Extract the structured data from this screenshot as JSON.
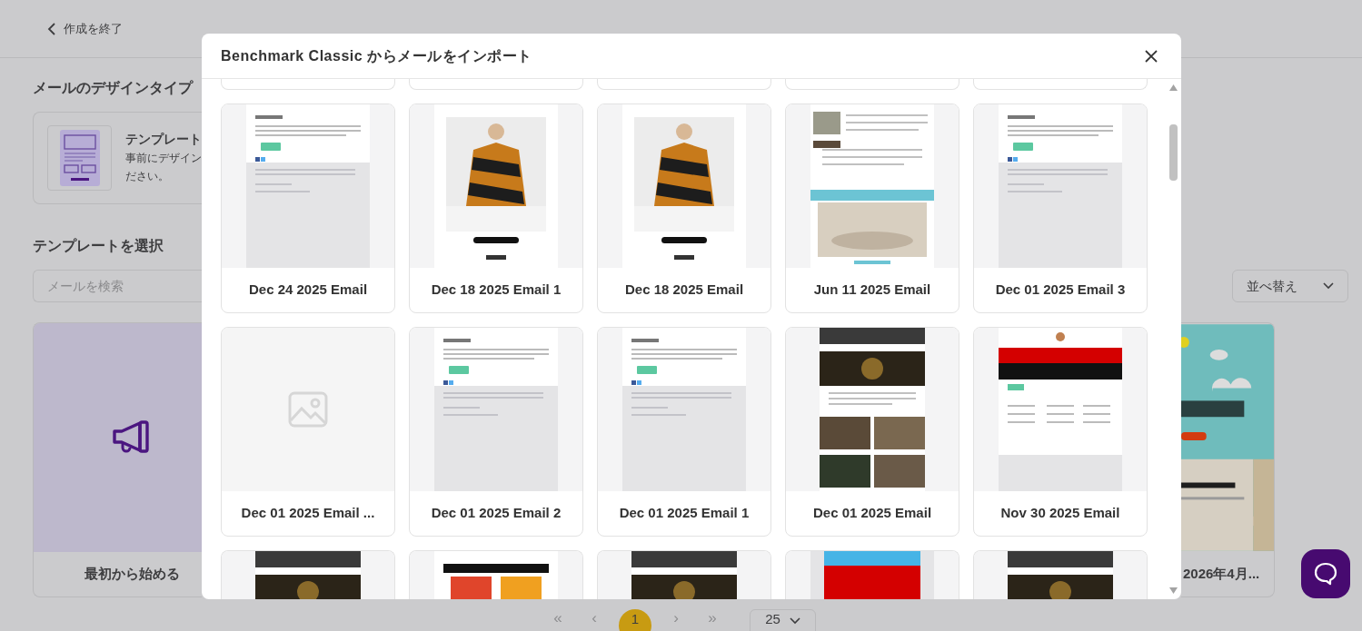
{
  "page": {
    "back_link": "作成を終了",
    "design_type": {
      "heading": "メールのデザインタイプ",
      "option_title": "テンプレート",
      "option_lines": [
        "事前にデザイン",
        "ださい。"
      ]
    },
    "select_heading": "テンプレートを選択",
    "search": {
      "placeholder": "メールを検索"
    },
    "sort": {
      "label": "並べ替え"
    },
    "cards": [
      {
        "kind": "blank",
        "label": "最初から始める"
      },
      {
        "kind": "picture",
        "label": "2026年4月..."
      }
    ],
    "pagination": [
      {
        "label": "«",
        "selected": false
      },
      {
        "label": "‹",
        "selected": false
      },
      {
        "label": "1",
        "selected": true
      },
      {
        "label": "›",
        "selected": false
      },
      {
        "label": "»",
        "selected": false
      }
    ],
    "page_size": "25"
  },
  "dialog": {
    "title": "Benchmark Classic からメールをインポート",
    "items": [
      {
        "kind": "edge"
      },
      {
        "kind": "edge"
      },
      {
        "kind": "edge"
      },
      {
        "kind": "edge"
      },
      {
        "kind": "edge"
      },
      {
        "kind": "picture",
        "label": "Dec 24 2025 Email"
      },
      {
        "kind": "picture",
        "label": "Dec 18 2025 Email 1"
      },
      {
        "kind": "picture",
        "label": "Dec 18 2025 Email"
      },
      {
        "kind": "picture",
        "label": "Jun 11 2025 Email"
      },
      {
        "kind": "picture",
        "label": "Dec 01 2025 Email 3"
      },
      {
        "kind": "empty",
        "label": "Dec 01 2025 Email ..."
      },
      {
        "kind": "picture",
        "label": "Dec 01 2025 Email 2"
      },
      {
        "kind": "picture",
        "label": "Dec 01 2025 Email 1"
      },
      {
        "kind": "picture",
        "label": "Dec 01 2025 Email"
      },
      {
        "kind": "picture",
        "label": "Nov 30 2025 Email"
      },
      {
        "kind": "picture"
      },
      {
        "kind": "picture"
      },
      {
        "kind": "picture"
      },
      {
        "kind": "picture"
      },
      {
        "kind": "picture"
      }
    ]
  }
}
